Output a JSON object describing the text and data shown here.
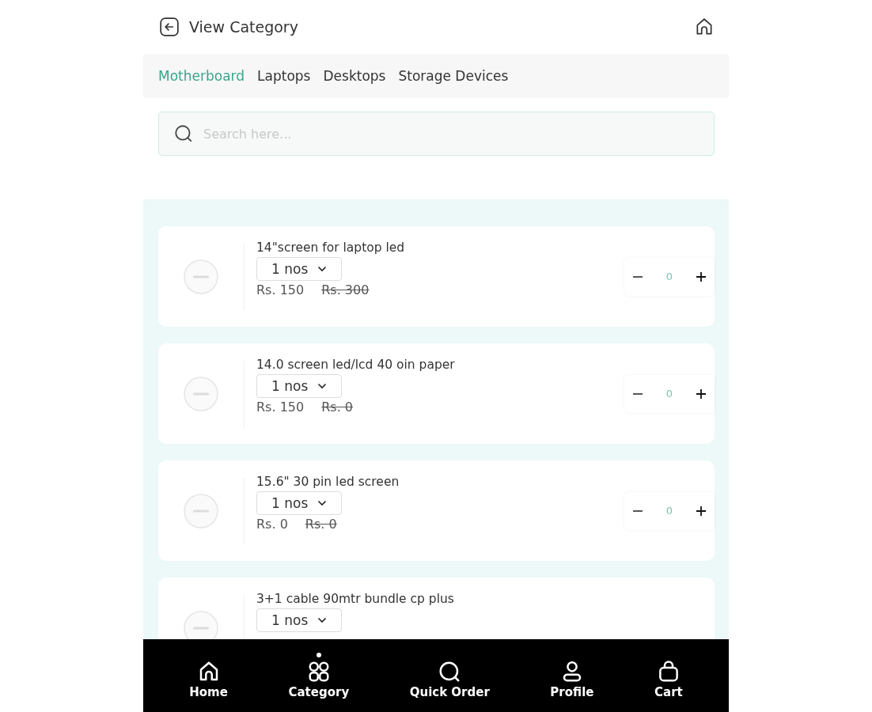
{
  "header": {
    "title": "View Category"
  },
  "tabs": [
    {
      "label": "Motherboard",
      "selected": true
    },
    {
      "label": "Laptops",
      "selected": false
    },
    {
      "label": "Desktops",
      "selected": false
    },
    {
      "label": "Storage Devices",
      "selected": false
    }
  ],
  "search": {
    "placeholder": "Search here..."
  },
  "products": [
    {
      "name": "14\"screen for laptop led",
      "unit": "1 nos",
      "price": "Rs. 150",
      "old_price": "Rs. 300",
      "qty": "0"
    },
    {
      "name": "14.0 screen led/lcd 40 oin paper",
      "unit": "1 nos",
      "price": "Rs. 150",
      "old_price": "Rs. 0",
      "qty": "0"
    },
    {
      "name": "15.6\" 30 pin led screen",
      "unit": "1 nos",
      "price": "Rs. 0",
      "old_price": "Rs. 0",
      "qty": "0"
    },
    {
      "name": "3+1 cable 90mtr bundle cp plus",
      "unit": "1 nos"
    }
  ],
  "bottom_nav": [
    {
      "label": "Home",
      "selected": false
    },
    {
      "label": "Category",
      "selected": true
    },
    {
      "label": "Quick Order",
      "selected": false
    },
    {
      "label": "Profile",
      "selected": false
    },
    {
      "label": "Cart",
      "selected": false
    }
  ]
}
